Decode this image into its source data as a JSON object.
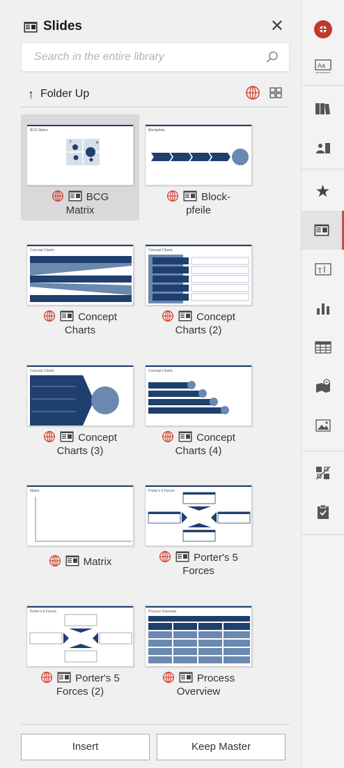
{
  "panel": {
    "title": "Slides",
    "close_label": "✕",
    "search_placeholder": "Search in the entire library",
    "folder_up_label": "Folder Up"
  },
  "tiles": [
    {
      "label": "BCG Matrix",
      "line1": "BCG",
      "line2": "Matrix",
      "thumb_title": "BCG Matrix",
      "selected": true
    },
    {
      "label": "Block-pfeile",
      "line1": "Block-",
      "line2": "pfeile",
      "thumb_title": "Blockpfeile"
    },
    {
      "label": "Concept Charts",
      "line1": "Concept",
      "line2": "Charts",
      "thumb_title": "Concept Charts"
    },
    {
      "label": "Concept Charts (2)",
      "line1": "Concept",
      "line2": "Charts (2)",
      "thumb_title": "Concept Charts"
    },
    {
      "label": "Concept Charts (3)",
      "line1": "Concept",
      "line2": "Charts (3)",
      "thumb_title": "Concept Charts"
    },
    {
      "label": "Concept Charts (4)",
      "line1": "Concept",
      "line2": "Charts (4)",
      "thumb_title": "Concept Charts"
    },
    {
      "label": "Matrix",
      "line1": "Matrix",
      "line2": "",
      "thumb_title": "Matrix"
    },
    {
      "label": "Porter's 5 Forces",
      "line1": "Porter's 5",
      "line2": "Forces",
      "thumb_title": "Porter's 5 Forces"
    },
    {
      "label": "Porter's 5 Forces (2)",
      "line1": "Porter's 5",
      "line2": "Forces (2)",
      "thumb_title": "Porter's 5 Forces"
    },
    {
      "label": "Process Overview",
      "line1": "Process",
      "line2": "Overview",
      "thumb_title": "Process Overview"
    }
  ],
  "buttons": {
    "insert": "Insert",
    "keep_master": "Keep Master"
  },
  "rail": {
    "items": [
      "app-logo-icon",
      "text-styles-icon",
      "library-icon",
      "people-icon",
      "favorites-icon",
      "slides-icon",
      "text-box-icon",
      "chart-icon",
      "table-icon",
      "map-icon",
      "picture-icon",
      "puzzle-icon",
      "clipboard-check-icon"
    ],
    "active": "slides-icon"
  },
  "colors": {
    "accent": "#c0504d",
    "navy": "#1f3f6e",
    "slate": "#6a88b0",
    "globe": "#d0402f"
  }
}
